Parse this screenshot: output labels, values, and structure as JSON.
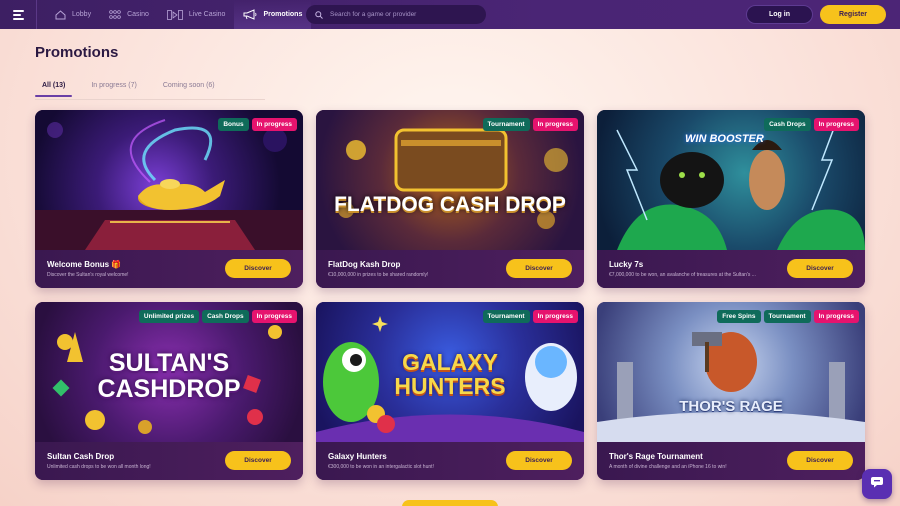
{
  "nav": {
    "items": [
      {
        "label": "Lobby",
        "icon": "home-icon"
      },
      {
        "label": "Casino",
        "icon": "grid-icon"
      },
      {
        "label": "Live Casino",
        "icon": "play-icon"
      },
      {
        "label": "Promotions",
        "icon": "megaphone-icon"
      }
    ],
    "search_placeholder": "Search for a game or provider",
    "login_label": "Log in",
    "register_label": "Register"
  },
  "page": {
    "title": "Promotions",
    "tabs": [
      {
        "label": "All (13)",
        "active": true
      },
      {
        "label": "In progress (7)",
        "active": false
      },
      {
        "label": "Coming soon (6)",
        "active": false
      }
    ]
  },
  "cards": [
    {
      "title": "Welcome Bonus 🎁",
      "desc": "Discover the Sultan's royal welcome!",
      "badges": [
        "Bonus",
        "In progress"
      ],
      "art_text": "",
      "button": "Discover"
    },
    {
      "title": "FlatDog Kash Drop",
      "desc": "€10,000,000 in prizes to be shared randomly!",
      "badges": [
        "Tournament",
        "In progress"
      ],
      "art_text": "FLATDOG CASH DROP",
      "button": "Discover"
    },
    {
      "title": "Lucky 7s",
      "desc": "€7,000,000 to be won, an avalanche of treasures at the Sultan's ...",
      "badges": [
        "Cash Drops",
        "In progress"
      ],
      "art_text": "WIN BOOSTER",
      "button": "Discover"
    },
    {
      "title": "Sultan Cash Drop",
      "desc": "Unlimited cash drops to be won all month long!",
      "badges": [
        "Unlimited prizes",
        "Cash Drops",
        "In progress"
      ],
      "art_text": "SULTAN'S CASHDROP",
      "button": "Discover"
    },
    {
      "title": "Galaxy Hunters",
      "desc": "€300,000 to be won in an intergalactic slot hunt!",
      "badges": [
        "Tournament",
        "In progress"
      ],
      "art_text": "GALAXY HUNTERS",
      "button": "Discover"
    },
    {
      "title": "Thor's Rage Tournament",
      "desc": "A month of divine challenge and an iPhone 16 to win!",
      "badges": [
        "Free Spins",
        "Tournament",
        "In progress"
      ],
      "art_text": "THOR'S RAGE",
      "button": "Discover"
    }
  ],
  "colors": {
    "accent": "#f7c21b",
    "nav_bg": "#4a2575",
    "badge_category": "#0f6b5a",
    "badge_progress": "#e6136e"
  }
}
